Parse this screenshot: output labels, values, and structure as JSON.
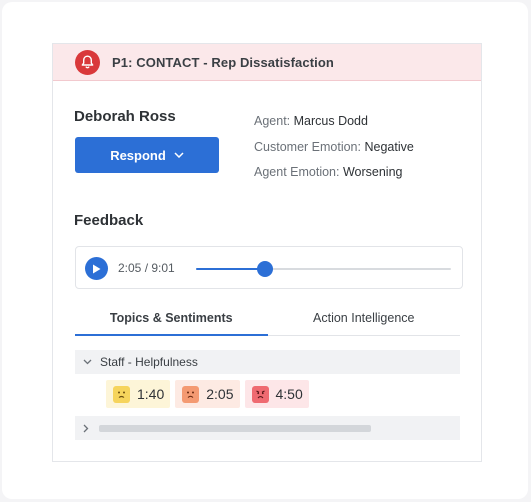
{
  "alert": {
    "title": "P1: CONTACT - Rep Dissatisfaction",
    "icon": "bell-icon",
    "color": "#d9393b"
  },
  "customer": {
    "name": "Deborah Ross"
  },
  "respond_button": {
    "label": "Respond",
    "color": "#2c6fd6"
  },
  "meta": {
    "agent_label": "Agent:",
    "agent_value": "Marcus Dodd",
    "customer_emotion_label": "Customer Emotion:",
    "customer_emotion_value": "Negative",
    "agent_emotion_label": "Agent Emotion:",
    "agent_emotion_value": "Worsening"
  },
  "feedback": {
    "title": "Feedback",
    "player": {
      "time": "2:05 / 9:01",
      "progress": 0.27
    }
  },
  "tabs": [
    {
      "label": "Topics & Sentiments",
      "active": true
    },
    {
      "label": "Action Intelligence",
      "active": false
    }
  ],
  "topics": [
    {
      "label": "Staff - Helpfulness",
      "expanded": true,
      "moments": [
        {
          "time": "1:40",
          "sentiment": "mild-negative",
          "icon": "frown-face-icon"
        },
        {
          "time": "2:05",
          "sentiment": "negative",
          "icon": "frown-face-icon"
        },
        {
          "time": "4:50",
          "sentiment": "very-negative",
          "icon": "angry-face-icon"
        }
      ]
    }
  ]
}
